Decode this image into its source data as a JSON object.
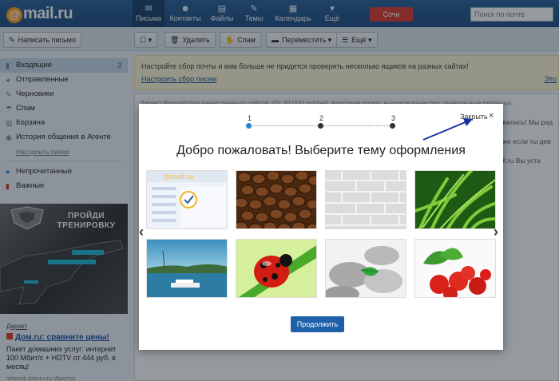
{
  "logo": {
    "at": "@",
    "text": "mail.ru"
  },
  "nav": [
    {
      "label": "Письма",
      "icon": "✉"
    },
    {
      "label": "Контакты",
      "icon": "☻"
    },
    {
      "label": "Файлы",
      "icon": "▤"
    },
    {
      "label": "Темы",
      "icon": "✎"
    },
    {
      "label": "Календарь",
      "icon": "▦"
    },
    {
      "label": "Ещё",
      "icon": "▾"
    }
  ],
  "header": {
    "exit_label": "Сочи",
    "search_placeholder": "Поиск по почте"
  },
  "toolbar": {
    "compose_label": "Написать письмо",
    "delete_label": "Удалить",
    "spam_label": "Спам",
    "move_label": "Переместить",
    "more_label": "Ещё"
  },
  "sidebar": {
    "folders": [
      {
        "label": "Входящие",
        "count": "3"
      },
      {
        "label": "Отправленные"
      },
      {
        "label": "Черновики"
      },
      {
        "label": "Спам"
      },
      {
        "label": "Корзина"
      },
      {
        "label": "История общения в Агенте"
      }
    ],
    "settings_link": "Настроить папки",
    "filters": [
      {
        "label": "Непрочитанные"
      },
      {
        "label": "Важные"
      }
    ]
  },
  "promo": {
    "text": "ПРОЙДИ ТРЕНИРОВКУ"
  },
  "ad": {
    "label": "Директ",
    "title": "Дом.ru: сравните цены!",
    "body": "Пакет домашних услуг: интернет 100 Мбит/с + HDTV от 444 руб. в месяц!",
    "domain": "izhevsk.domru.ru Иркутск"
  },
  "notice": {
    "text": "Настройте сбор почты и вам больше не придется проверять несколько ящиков на разных сайтах!",
    "link": "Настроить сбор писем",
    "right_link": "Это"
  },
  "list": {
    "direct_row": "Директ   Разработка качественных сайтов. От 20 000 рублей. Короткие сроки, высокое качество, уникальные решения.",
    "bg_messages": [
      "явились! Мы рад",
      "вже если ты дев",
      "ail.ru Вы уста"
    ]
  },
  "modal": {
    "close_label": "Закрыть",
    "close_icon": "×",
    "steps": [
      "1",
      "2",
      "3"
    ],
    "title": "Добро пожаловать! Выберите тему оформления",
    "themes": [
      {
        "name": "Стандартная"
      },
      {
        "name": "Кофе"
      },
      {
        "name": "Кирпич"
      },
      {
        "name": "Трава"
      },
      {
        "name": "Лайнер"
      },
      {
        "name": "Божья коровка"
      },
      {
        "name": "Камни"
      },
      {
        "name": "Клубника"
      }
    ],
    "thumb_logo": "@mail.ru",
    "continue_label": "Продолжить"
  },
  "colors": {
    "accent": "#1d5fa8",
    "header": "#2a5f99",
    "logo": "#ff9e1a",
    "exit": "#e03a2e"
  }
}
